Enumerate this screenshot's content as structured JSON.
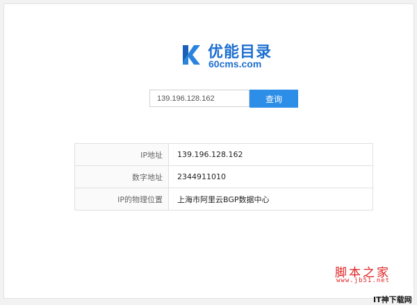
{
  "brand": {
    "name_cn": "优能目录",
    "domain": "60cms.com",
    "color": "#1e6fd0"
  },
  "search": {
    "value": "139.196.128.162",
    "button_label": "查询",
    "button_color": "#2d8ee8"
  },
  "results": {
    "rows": [
      {
        "label": "IP地址",
        "value": "139.196.128.162"
      },
      {
        "label": "数字地址",
        "value": "2344911010"
      },
      {
        "label": "IP的物理位置",
        "value": "上海市阿里云BGP数据中心"
      }
    ]
  },
  "watermark": {
    "site_name": "脚本之家",
    "site_url": "www.jb51.net",
    "corner_text": "IT神下载网",
    "color": "#e02020"
  }
}
